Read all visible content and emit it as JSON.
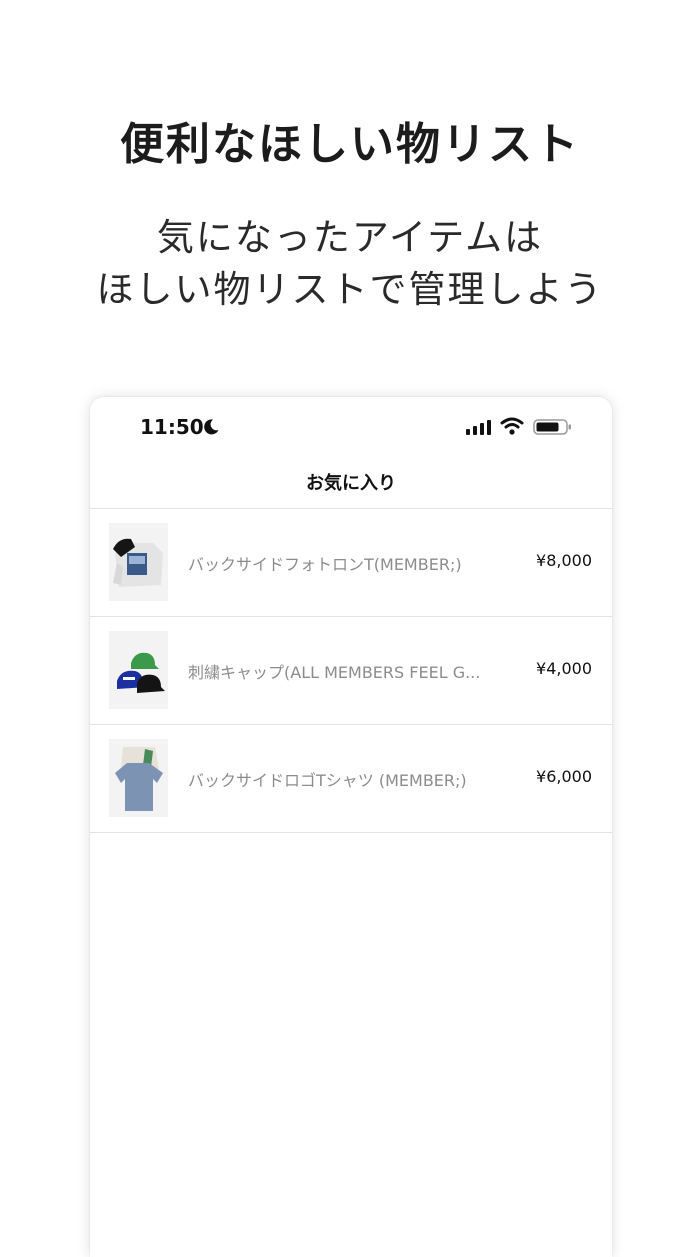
{
  "promo": {
    "title": "便利なほしい物リスト",
    "subtitle_line1": "気になったアイテムは",
    "subtitle_line2": "ほしい物リストで管理しよう"
  },
  "status_bar": {
    "time": "11:50"
  },
  "nav": {
    "title": "お気に入り"
  },
  "favorites": [
    {
      "name": "バックサイドフォトロンT(MEMBER;)",
      "price": "¥8,000"
    },
    {
      "name": "刺繍キャップ(ALL MEMBERS FEEL G...",
      "price": "¥4,000"
    },
    {
      "name": "バックサイドロゴTシャツ (MEMBER;)",
      "price": "¥6,000"
    }
  ]
}
